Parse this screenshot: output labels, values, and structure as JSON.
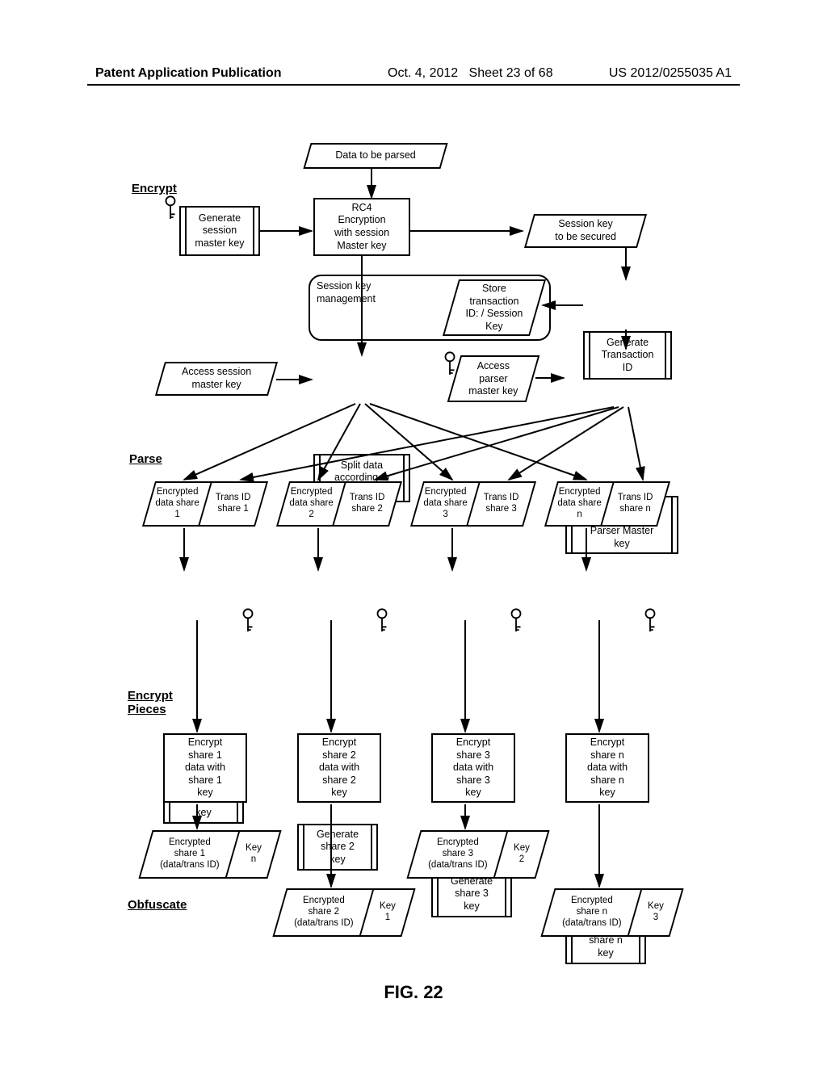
{
  "header": {
    "left": "Patent Application Publication",
    "date": "Oct. 4, 2012",
    "sheet": "Sheet 23 of 68",
    "pubno": "US 2012/0255035 A1"
  },
  "figure_caption": "FIG. 22",
  "sections": {
    "encrypt": "Encrypt",
    "parse": "Parse",
    "encrypt_pieces": "Encrypt\nPieces",
    "obfuscate": "Obfuscate"
  },
  "nodes": {
    "data_to_be_parsed": "Data to be parsed",
    "gen_session_master_key": "Generate\nsession\nmaster key",
    "rc4": "RC4\nEncryption\nwith session\nMaster key",
    "session_key_secured": "Session key\nto be secured",
    "session_key_mgmt": "Session key\nmanagement",
    "store_trans": "Store\ntransaction\nID: / Session\nKey",
    "gen_trans_id": "Generate\nTransaction\nID",
    "access_session_mk": "Access session\nmaster key",
    "split_data": "Split data\naccording to\nsession key",
    "access_parser_mk": "Access\nparser\nmaster key",
    "split_trans_id": "Split transaction\nID according to\nParser Master\nkey",
    "enc_data_share": "Encrypted\ndata\nshare",
    "trans_id_share": "Trans\nID\nshare",
    "gen_share_key": "Generate\nshare",
    "key_word": "key",
    "enc_share_data_with": "Encrypt\nshare",
    "data_with": "data with\nshare",
    "enc_share_out": "Encrypted\nshare",
    "data_trans_id": "(data/trans ID)",
    "key_label": "Key"
  },
  "share_indices": [
    "1",
    "2",
    "3",
    "n"
  ],
  "obfuscate_keys": [
    "n",
    "1",
    "2",
    "3"
  ]
}
